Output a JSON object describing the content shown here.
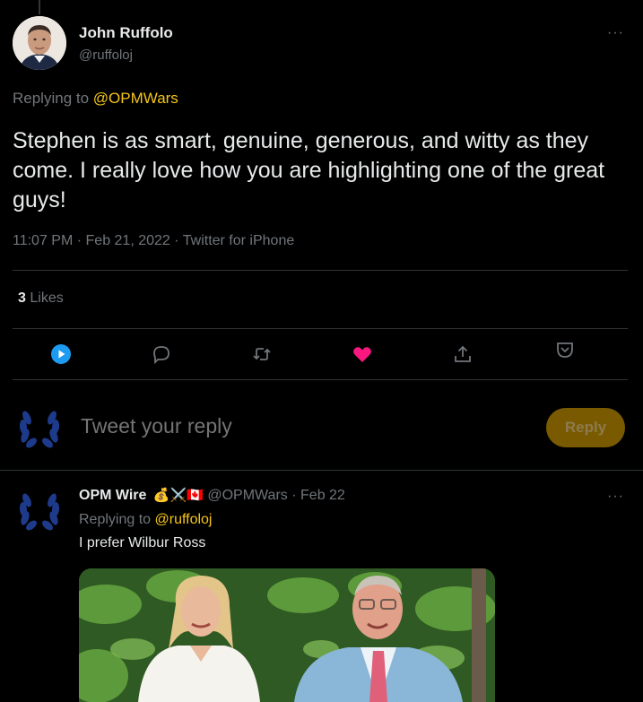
{
  "tweet": {
    "author_name": "John Ruffolo",
    "author_handle": "@ruffoloj",
    "replying_prefix": "Replying to",
    "replying_to": "@OPMWars",
    "text": "Stephen is as smart, genuine, generous, and witty as they come. I really love how you are highlighting one of the great guys!",
    "meta": "11:07 PM · Feb 21, 2022 · Twitter for iPhone",
    "likes_count": "3",
    "likes_label": "Likes",
    "more": "···"
  },
  "reply_box": {
    "placeholder": "Tweet your reply",
    "button_label": "Reply"
  },
  "reply": {
    "author_name": "OPM Wire",
    "emoji": "💰⚔️🇨🇦",
    "author_handle": "@OPMWars",
    "date": "Feb 22",
    "replying_prefix": "Replying to",
    "replying_to": "@ruffoloj",
    "text": "I prefer Wilbur Ross",
    "more": "···"
  },
  "colors": {
    "accent": "#f5c518",
    "like": "#f91880",
    "play": "#1d9bf0"
  }
}
